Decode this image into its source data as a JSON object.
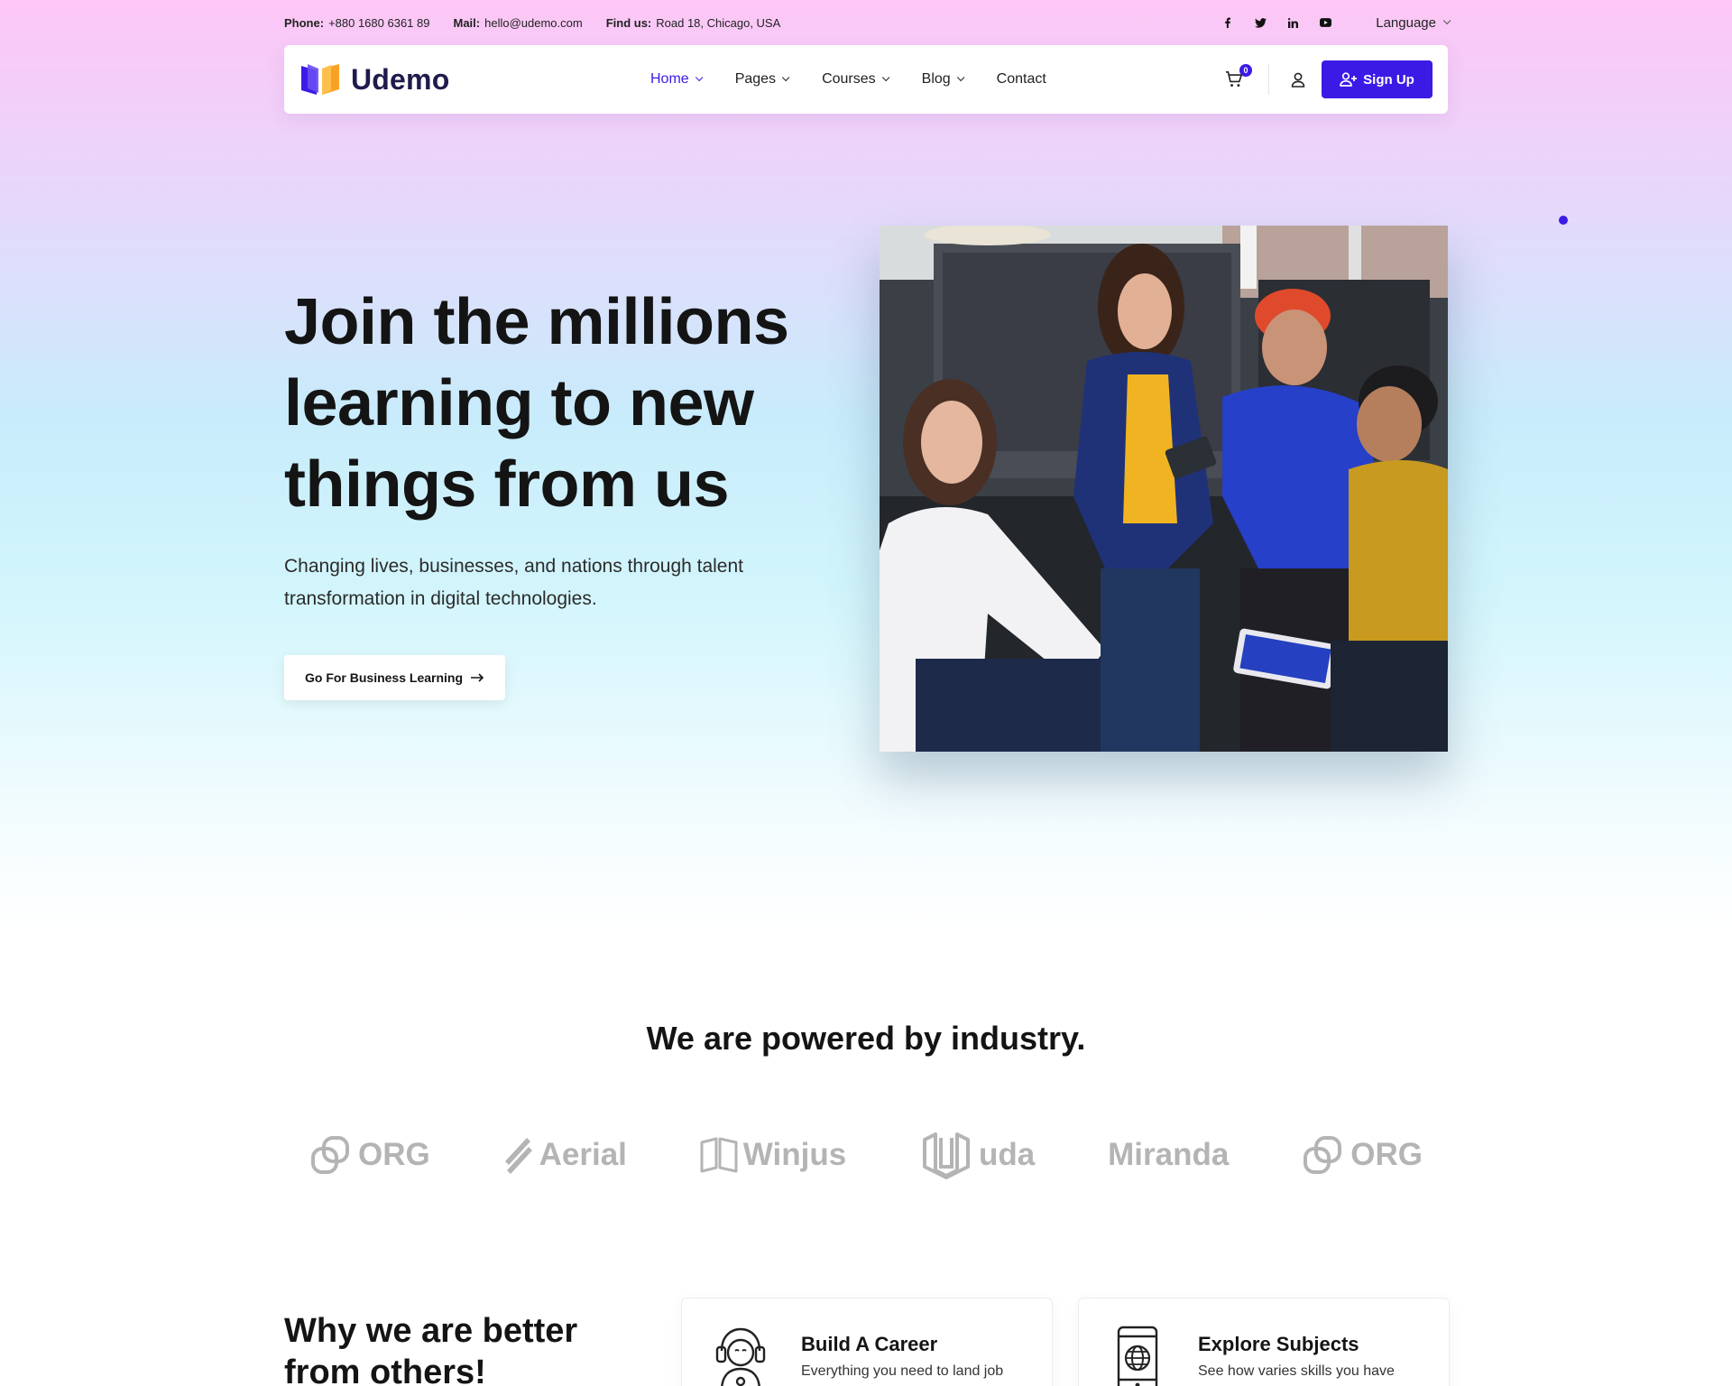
{
  "topbar": {
    "phone_label": "Phone:",
    "phone": "+880 1680 6361 89",
    "mail_label": "Mail:",
    "mail": "hello@udemo.com",
    "find_label": "Find us:",
    "address": "Road 18, Chicago, USA",
    "social": [
      "facebook-icon",
      "twitter-icon",
      "linkedin-icon",
      "youtube-icon"
    ],
    "language": "Language"
  },
  "nav": {
    "brand": "Udemo",
    "items": [
      {
        "label": "Home",
        "dropdown": true,
        "active": true
      },
      {
        "label": "Pages",
        "dropdown": true
      },
      {
        "label": "Courses",
        "dropdown": true
      },
      {
        "label": "Blog",
        "dropdown": true
      },
      {
        "label": "Contact",
        "dropdown": false
      }
    ],
    "cart_count": "0",
    "signup": "Sign Up"
  },
  "hero": {
    "title": "Join the millions learning to new things from us",
    "subtitle": "Changing lives, businesses, and nations through talent transformation in digital technologies.",
    "cta": "Go For Business Learning"
  },
  "industry": {
    "heading": "We are powered by industry.",
    "brands": [
      "ORG",
      "Aerial",
      "Winjus",
      "uda",
      "Miranda",
      "ORG"
    ]
  },
  "why": {
    "heading": "Why we are better from others!",
    "cards": [
      {
        "title": "Build A Career",
        "desc": "Everything you need to land job",
        "icon": "headset-user-icon"
      },
      {
        "title": "Explore Subjects",
        "desc": "See how varies skills you have",
        "icon": "phone-globe-icon"
      }
    ]
  },
  "colors": {
    "accent": "#3c1ae6",
    "brand_dark": "#1f1b4d",
    "logo_book_blue": "#3c1ae6",
    "logo_book_orange": "#f7a224",
    "brand_logo_grey": "#b4b4b4"
  }
}
